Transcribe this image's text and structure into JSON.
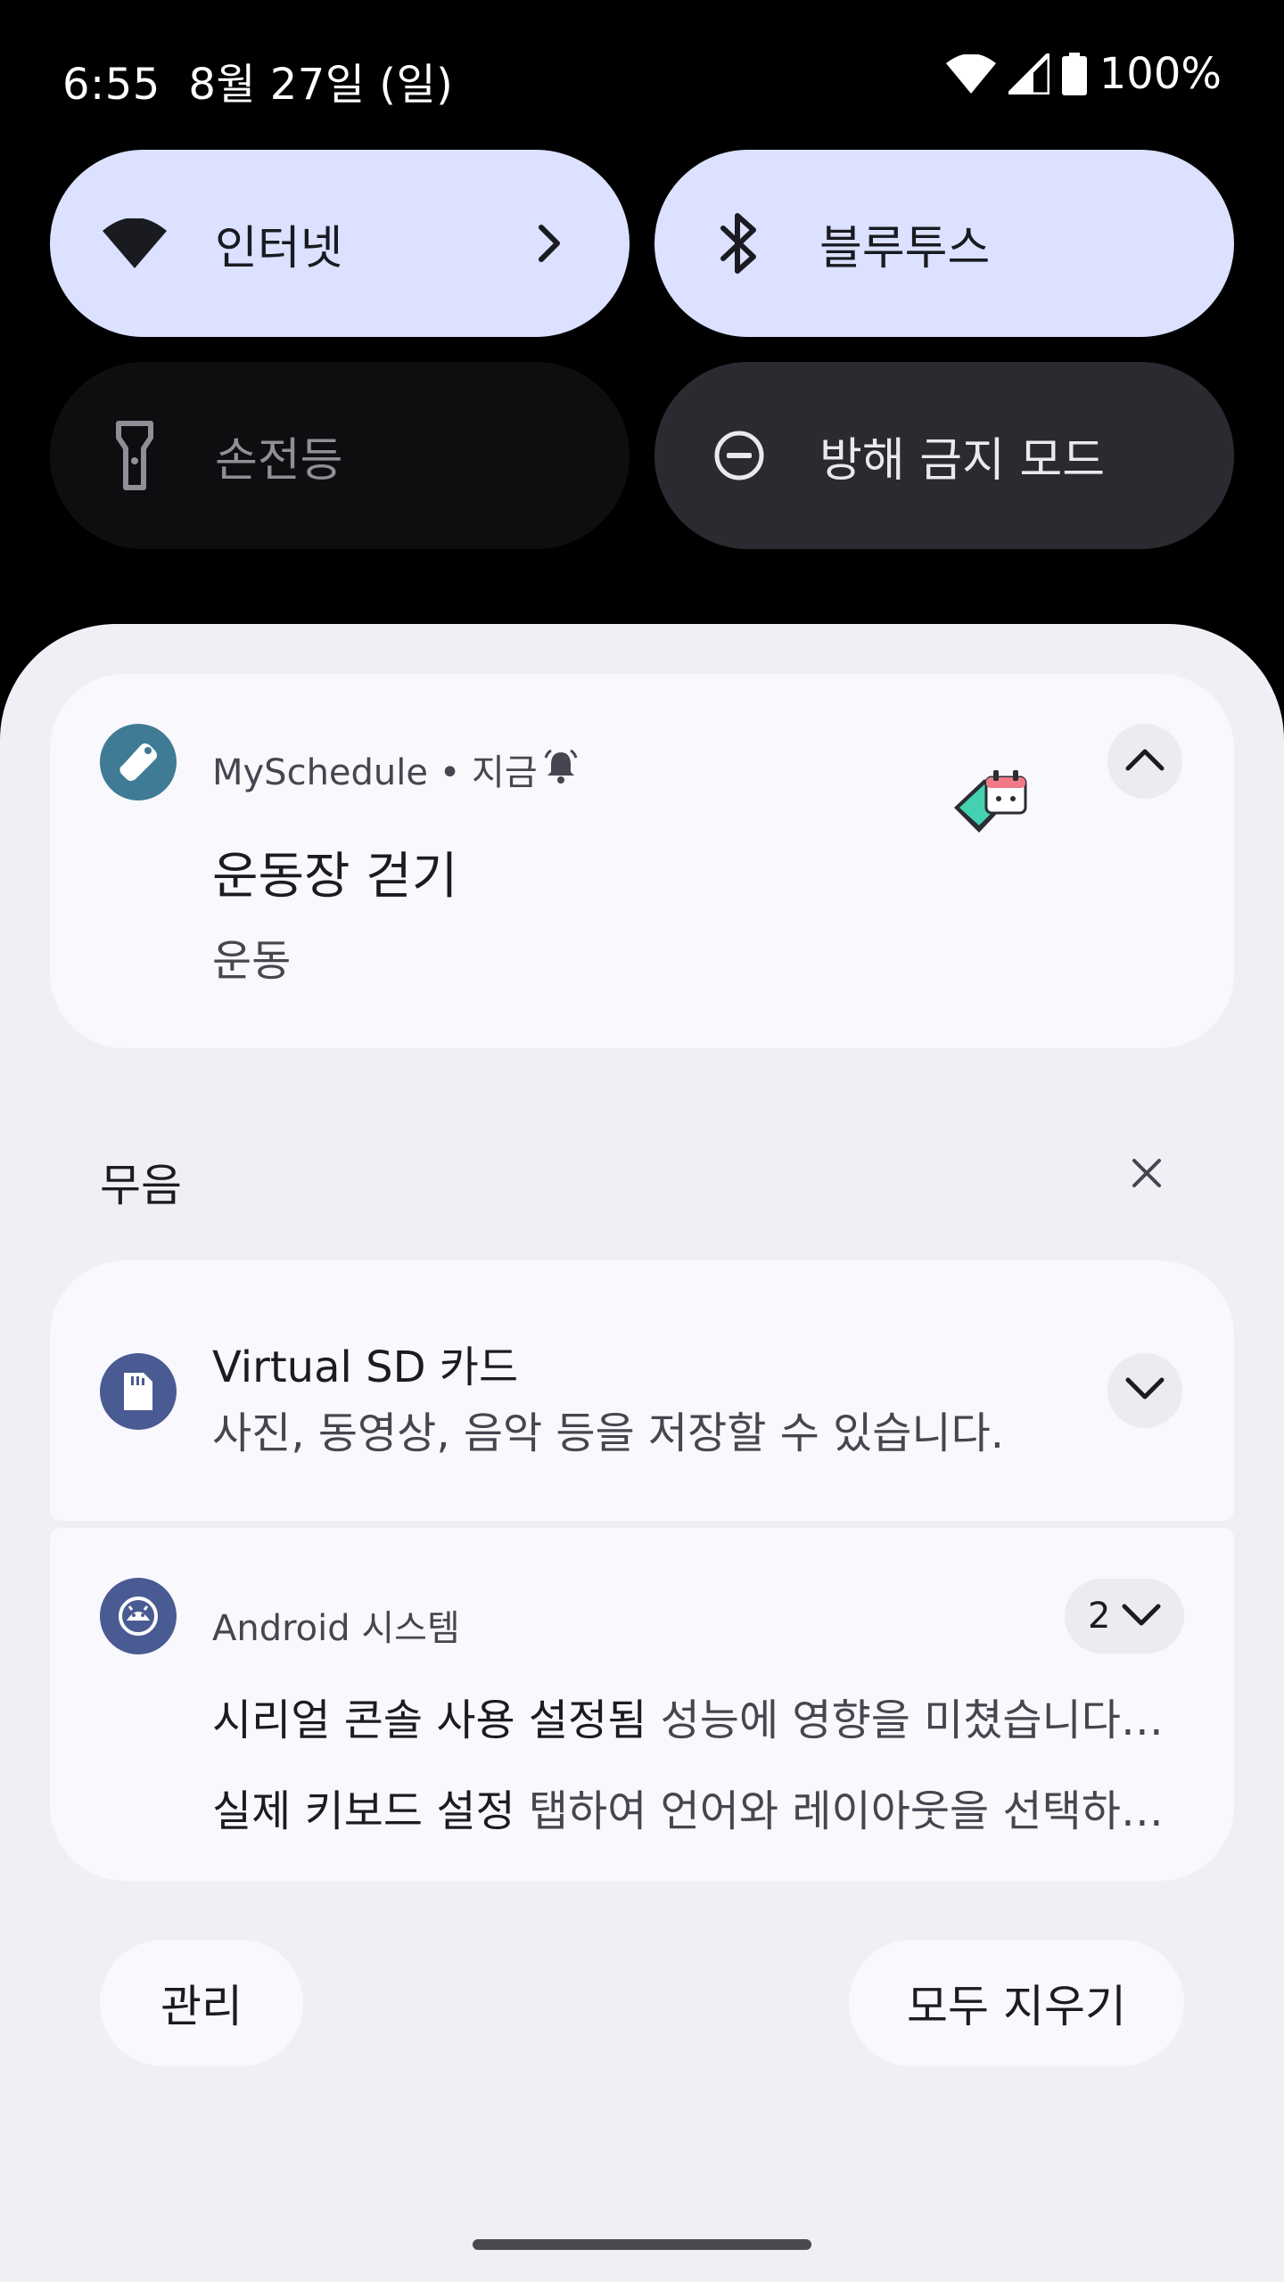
{
  "status_bar": {
    "time": "6:55",
    "date": "8월 27일 (일)",
    "battery": "100%",
    "icons": [
      "wifi-icon",
      "signal-icon",
      "battery-icon"
    ]
  },
  "quick_settings": {
    "tiles": [
      {
        "label": "인터넷",
        "icon": "wifi-icon",
        "active": true,
        "has_chevron": true
      },
      {
        "label": "블루투스",
        "icon": "bluetooth-icon",
        "active": true
      },
      {
        "label": "손전등",
        "icon": "flashlight-icon",
        "active": false
      },
      {
        "label": "방해 금지 모드",
        "icon": "do-not-disturb-icon",
        "active": false
      }
    ]
  },
  "notifications": {
    "myschedule": {
      "app_name": "MySchedule",
      "separator": "•",
      "time": "지금",
      "title": "운동장 걷기",
      "text": "운동",
      "icon": "myschedule-app-icon",
      "bell_icon": "alarm-bell-icon"
    },
    "silent_section": {
      "label": "무음"
    },
    "sd_card": {
      "title": "Virtual SD 카드",
      "text": "사진, 동영상, 음악 등을 저장할 수 있습니다.",
      "icon": "sd-card-icon"
    },
    "android_system": {
      "app_name": "Android 시스템",
      "count": "2",
      "lines": [
        {
          "bold": "시리얼 콘솔 사용 설정됨",
          "rest": " 성능에 영향을 미쳤습니다. 부트로더를 확인하세요."
        },
        {
          "bold": "실제 키보드 설정",
          "rest": " 탭하여 언어와 레이아웃을 선택하세요."
        }
      ],
      "icon": "android-system-icon"
    }
  },
  "footer": {
    "manage_label": "관리",
    "clear_all_label": "모두 지우기"
  },
  "colors": {
    "tile_active": "#dbe1ff",
    "shade_bg": "#efeff5",
    "card_bg": "#f8f8fd",
    "app_icon_teal": "#3f7b94",
    "app_icon_indigo": "#4a5a92"
  }
}
